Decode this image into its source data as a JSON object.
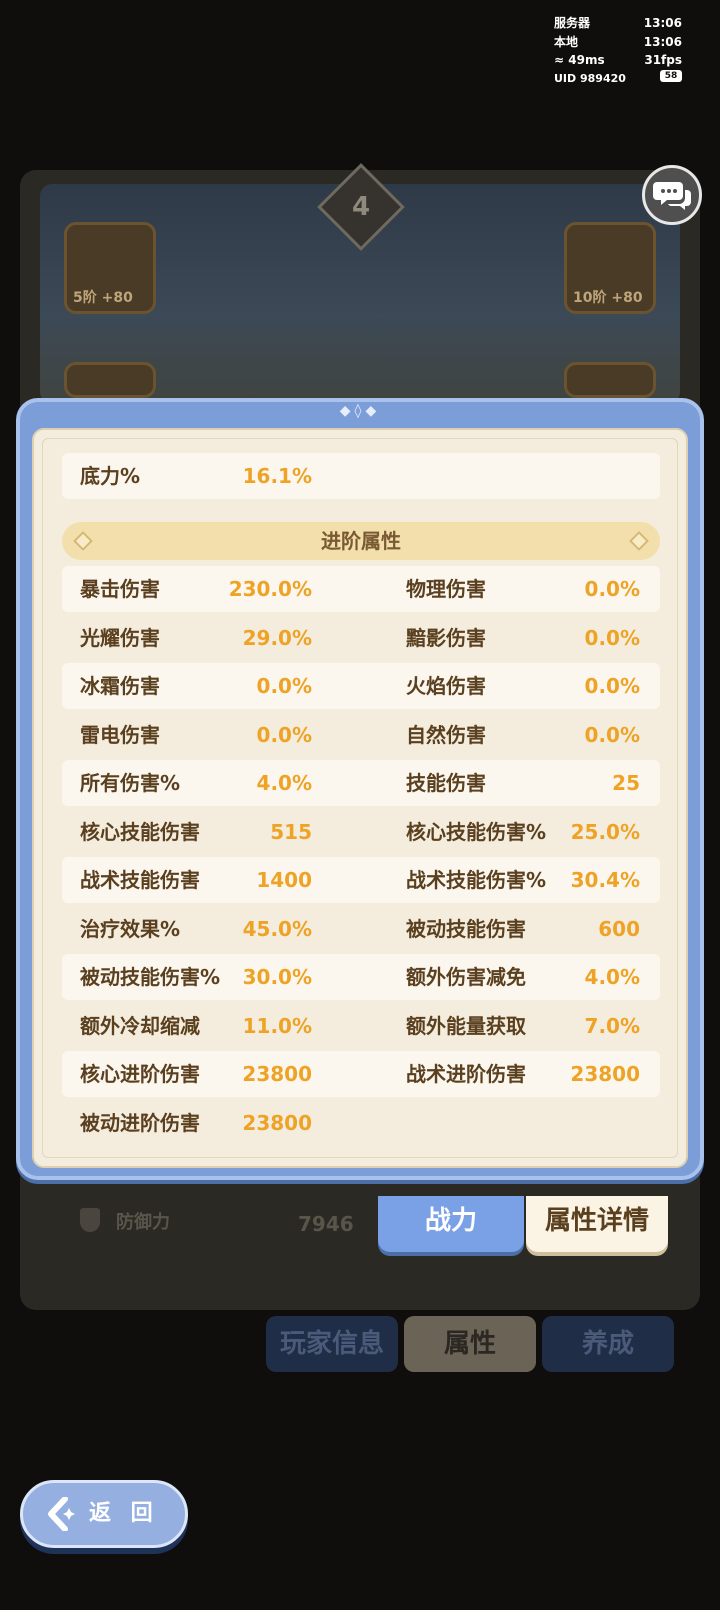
{
  "status_bar": {
    "server_label": "服务器",
    "server_time": "13:06",
    "local_label": "本地",
    "local_time": "13:06",
    "ping": "49ms",
    "fps": "31fps",
    "uid": "UID 989420",
    "battery": "58"
  },
  "background": {
    "level": "4",
    "left_slot_level": "5阶 +80",
    "right_slot_level": "10阶 +80",
    "defense_label": "防御力",
    "defense_value": "7946",
    "tabs": [
      "玩家信息",
      "属性",
      "养成"
    ]
  },
  "stats_panel": {
    "top_stat": {
      "name": "底力%",
      "value": "16.1%"
    },
    "section_title": "进阶属性",
    "rows": [
      [
        {
          "name": "暴击伤害",
          "value": "230.0%"
        },
        {
          "name": "物理伤害",
          "value": "0.0%"
        }
      ],
      [
        {
          "name": "光耀伤害",
          "value": "29.0%"
        },
        {
          "name": "黯影伤害",
          "value": "0.0%"
        }
      ],
      [
        {
          "name": "冰霜伤害",
          "value": "0.0%"
        },
        {
          "name": "火焰伤害",
          "value": "0.0%"
        }
      ],
      [
        {
          "name": "雷电伤害",
          "value": "0.0%"
        },
        {
          "name": "自然伤害",
          "value": "0.0%"
        }
      ],
      [
        {
          "name": "所有伤害%",
          "value": "4.0%"
        },
        {
          "name": "技能伤害",
          "value": "25"
        }
      ],
      [
        {
          "name": "核心技能伤害",
          "value": "515"
        },
        {
          "name": "核心技能伤害%",
          "value": "25.0%"
        }
      ],
      [
        {
          "name": "战术技能伤害",
          "value": "1400"
        },
        {
          "name": "战术技能伤害%",
          "value": "30.4%"
        }
      ],
      [
        {
          "name": "治疗效果%",
          "value": "45.0%"
        },
        {
          "name": "被动技能伤害",
          "value": "600"
        }
      ],
      [
        {
          "name": "被动技能伤害%",
          "value": "30.0%"
        },
        {
          "name": "额外伤害减免",
          "value": "4.0%"
        }
      ],
      [
        {
          "name": "额外冷却缩减",
          "value": "11.0%"
        },
        {
          "name": "额外能量获取",
          "value": "7.0%"
        }
      ],
      [
        {
          "name": "核心进阶伤害",
          "value": "23800"
        },
        {
          "name": "战术进阶伤害",
          "value": "23800"
        }
      ],
      [
        {
          "name": "被动进阶伤害",
          "value": "23800"
        },
        null
      ]
    ]
  },
  "tabs": {
    "combat": "战力",
    "detail": "属性详情"
  },
  "back_button": "返 回",
  "colors": {
    "panel_blue": "#7c9ed8",
    "panel_cream": "#f4edde",
    "stat_name": "#5b4020",
    "stat_value": "#eea326",
    "section_bg": "#f2dfab"
  }
}
